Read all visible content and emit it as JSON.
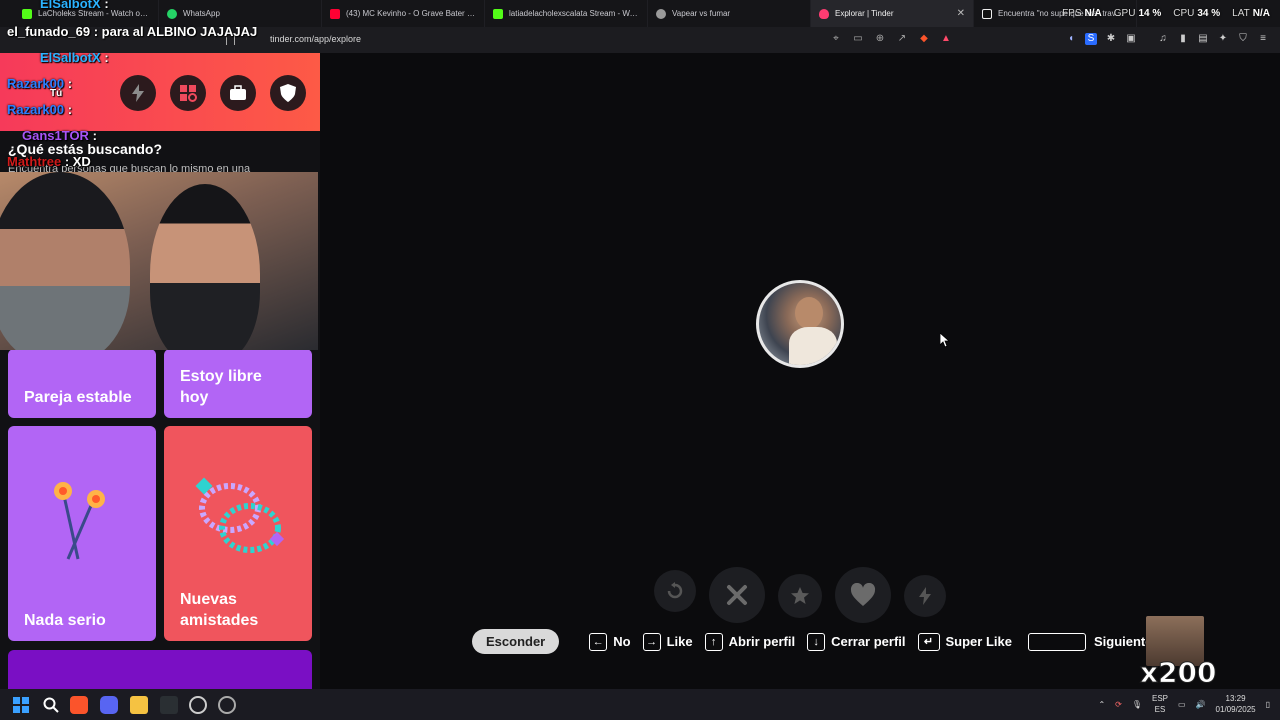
{
  "tabs": [
    {
      "title": "LaCholeks Stream - Watch on K",
      "color": "#53fc18",
      "active": false
    },
    {
      "title": "WhatsApp",
      "color": "#25d366",
      "active": false
    },
    {
      "title": "(43) MC Kevinho - O Grave Bater [Sir",
      "color": "#ff0033",
      "active": false
    },
    {
      "title": "latiadelacholexscalata Stream - Watc",
      "color": "#53fc18",
      "active": false
    },
    {
      "title": "Vapear vs fumar",
      "color": "#9a9a9a",
      "active": false
    },
    {
      "title": "Explorar | Tinder",
      "color": "#fe3c72",
      "active": true
    },
    {
      "title": "Encuentra \"no supe que era\" travesti",
      "color": "#eeeeee",
      "active": false
    }
  ],
  "stats": {
    "fps_label": "FPS",
    "fps_value": "N/A",
    "gpu_label": "GPU",
    "gpu_value": "14 %",
    "cpu_label": "CPU",
    "cpu_value": "34 %",
    "lat_label": "LAT",
    "lat_value": "N/A"
  },
  "address": {
    "url": "tinder.com/app/explore"
  },
  "sidebar": {
    "title": "¿Qué estás buscando?",
    "subtitle": "Encuentra personas que buscan lo mismo en una",
    "cards": [
      {
        "label": "Pareja estable",
        "color": "#b265f5"
      },
      {
        "label": "Estoy libre hoy",
        "color": "#b265f5"
      },
      {
        "label": "Nada serio",
        "color": "#b265f5"
      },
      {
        "label": "Nuevas amistades",
        "color": "#f0555d"
      }
    ]
  },
  "chat": [
    {
      "user": "ElSalbotX",
      "text": ":",
      "color": "#2bb3ff"
    },
    {
      "user": "el_funado_69",
      "text": ": para al ALBINO JAJAJAJ",
      "color": "#ffffff"
    },
    {
      "user": "ElSalbotX",
      "text": ":",
      "color": "#2bb3ff"
    },
    {
      "user": "Razark00",
      "text": ":",
      "color": "#2a7fff"
    },
    {
      "user": "Tú",
      "text": "",
      "color": "#ffffff"
    },
    {
      "user": "Razark00",
      "text": ":",
      "color": "#2a7fff"
    },
    {
      "user": "Gans1TOR",
      "text": ":",
      "color": "#a855f7"
    },
    {
      "user": "Mathtree",
      "text": ": XD",
      "color": "#d11a1a"
    }
  ],
  "actions": {
    "rewind_icon": "rewind-icon",
    "nope_icon": "x-icon",
    "superlike_icon": "star-icon",
    "like_icon": "heart-icon",
    "boost_icon": "bolt-icon"
  },
  "hints": {
    "hide": "Esconder",
    "no": "No",
    "like": "Like",
    "open_profile": "Abrir perfil",
    "close_profile": "Cerrar perfil",
    "super_like": "Super Like",
    "next_photo": "Siguiente foto"
  },
  "emote": {
    "multiplier": "x200"
  },
  "tray": {
    "lang1": "ESP",
    "lang2": "ES",
    "time": "13:29",
    "date": "01/09/2025"
  }
}
